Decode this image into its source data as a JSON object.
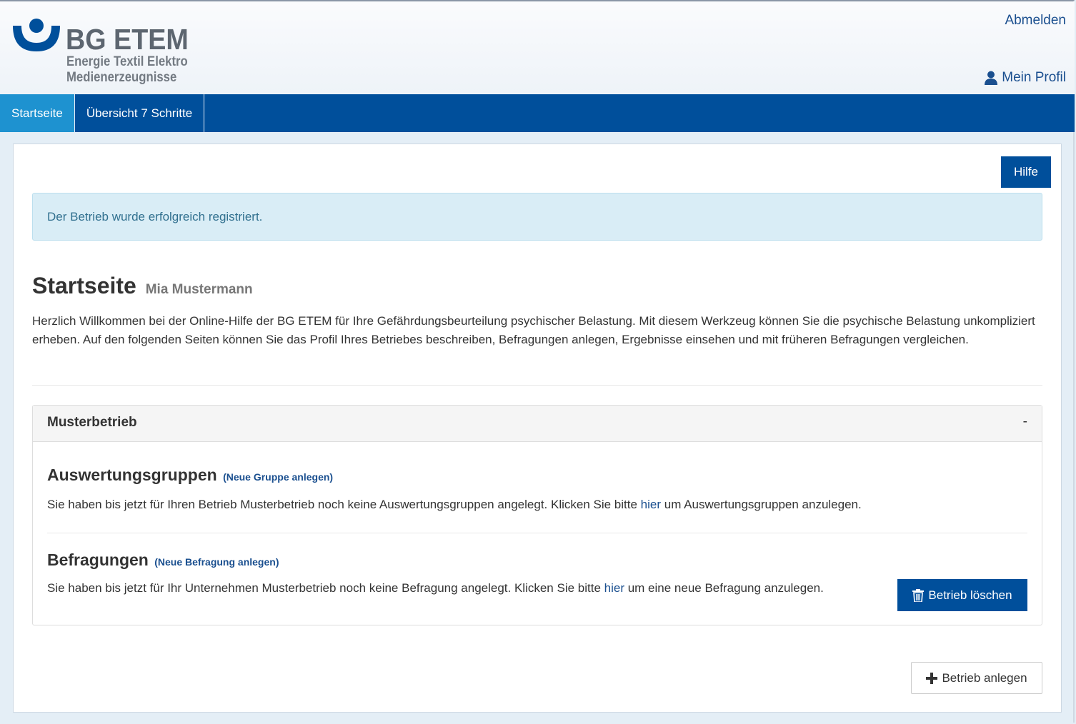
{
  "header": {
    "logo": {
      "title": "BG ETEM",
      "subtitle_line1": "Energie Textil Elektro",
      "subtitle_line2": "Medienerzeugnisse",
      "icon": "bg-etem-logo-icon",
      "brand_color": "#004f9b"
    },
    "logout_label": "Abmelden",
    "profile_label": "Mein Profil",
    "profile_icon": "user-icon"
  },
  "nav": {
    "items": [
      {
        "label": "Startseite",
        "active": true
      },
      {
        "label": "Übersicht 7 Schritte",
        "active": false
      }
    ]
  },
  "main": {
    "help_label": "Hilfe",
    "alert_text": "Der Betrieb wurde erfolgreich registriert.",
    "title": "Startseite",
    "subtitle": "Mia Mustermann",
    "intro": "Herzlich Willkommen bei der Online-Hilfe der BG ETEM für Ihre Gefährdungsbeurteilung psychischer Belastung. Mit diesem Werkzeug können Sie die psychische Belastung unkompliziert erheben. Auf den folgenden Seiten können Sie das Profil Ihres Betriebes beschreiben, Befragungen anlegen, Ergebnisse einsehen und mit früheren Befragungen vergleichen.",
    "company": {
      "name": "Musterbetrieb",
      "collapse_label": "-",
      "groups": {
        "title": "Auswertungsgruppen",
        "new_link": "(Neue Gruppe anlegen)",
        "text_before": "Sie haben bis jetzt für Ihren Betrieb Musterbetrieb noch keine Auswertungsgruppen angelegt. Klicken Sie bitte ",
        "link": "hier",
        "text_after": " um Auswertungsgruppen anzulegen."
      },
      "surveys": {
        "title": "Befragungen",
        "new_link": "(Neue Befragung anlegen)",
        "text_before": "Sie haben bis jetzt für Ihr Unternehmen Musterbetrieb noch keine Befragung angelegt. Klicken Sie bitte ",
        "link": "hier",
        "text_after": " um eine neue Befragung anzulegen."
      },
      "delete_label": "Betrieb löschen",
      "delete_icon": "trash-icon"
    },
    "add_label": "Betrieb anlegen",
    "add_icon": "plus-icon"
  },
  "colors": {
    "navbar": "#004f9b",
    "nav_active": "#1e92d0",
    "alert_bg": "#d9edf6",
    "alert_text": "#31708f",
    "link": "#1a4f8f"
  }
}
